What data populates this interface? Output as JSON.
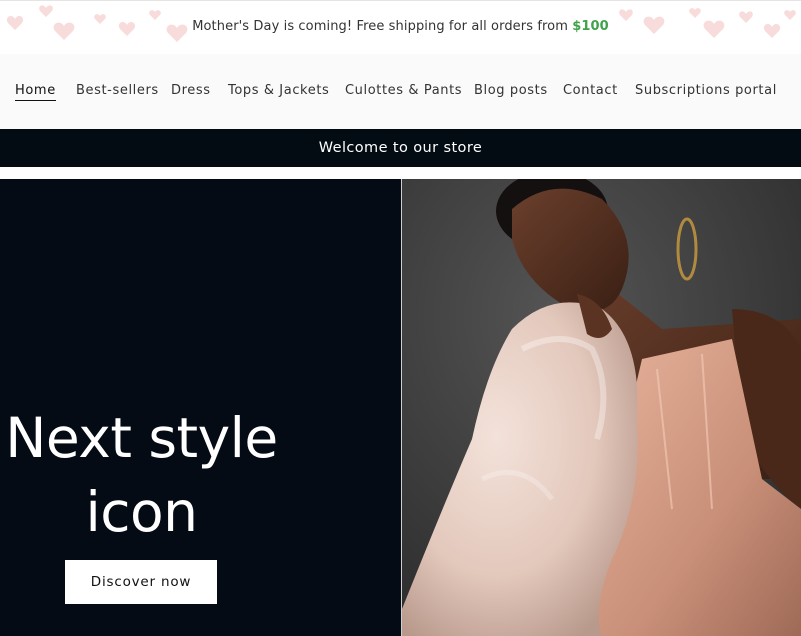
{
  "announcement": {
    "text": "Mother's Day is coming! Free shipping for all orders from ",
    "amount": "$100",
    "amount_color": "#3fa34a"
  },
  "nav": {
    "items": [
      {
        "label": "Home",
        "active": true
      },
      {
        "label": "Best-sellers"
      },
      {
        "label": "Dress"
      },
      {
        "label": "Tops & Jackets"
      },
      {
        "label": "Culottes & Pants"
      },
      {
        "label": "Blog posts"
      },
      {
        "label": "Contact"
      },
      {
        "label": "Subscriptions portal"
      }
    ]
  },
  "welcome": {
    "text": "Welcome to our store",
    "background": "#030b13"
  },
  "hero": {
    "title_line1": "Next style",
    "title_line2": "icon",
    "button_label": "Discover now",
    "background": "#050b15",
    "image_icon": "fashion-model-photo"
  },
  "colors": {
    "hearts": "#f7d5d5"
  }
}
